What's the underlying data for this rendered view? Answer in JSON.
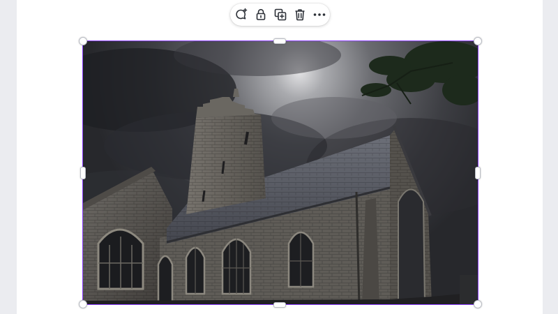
{
  "toolbar": {
    "actions": [
      {
        "icon": "comment-add-icon"
      },
      {
        "icon": "lock-icon"
      },
      {
        "icon": "duplicate-icon"
      },
      {
        "icon": "delete-icon"
      },
      {
        "icon": "more-options-icon"
      }
    ]
  },
  "selection": {
    "accent_color": "#8b3dff"
  },
  "image": {
    "subject": "photo-church-storm"
  }
}
